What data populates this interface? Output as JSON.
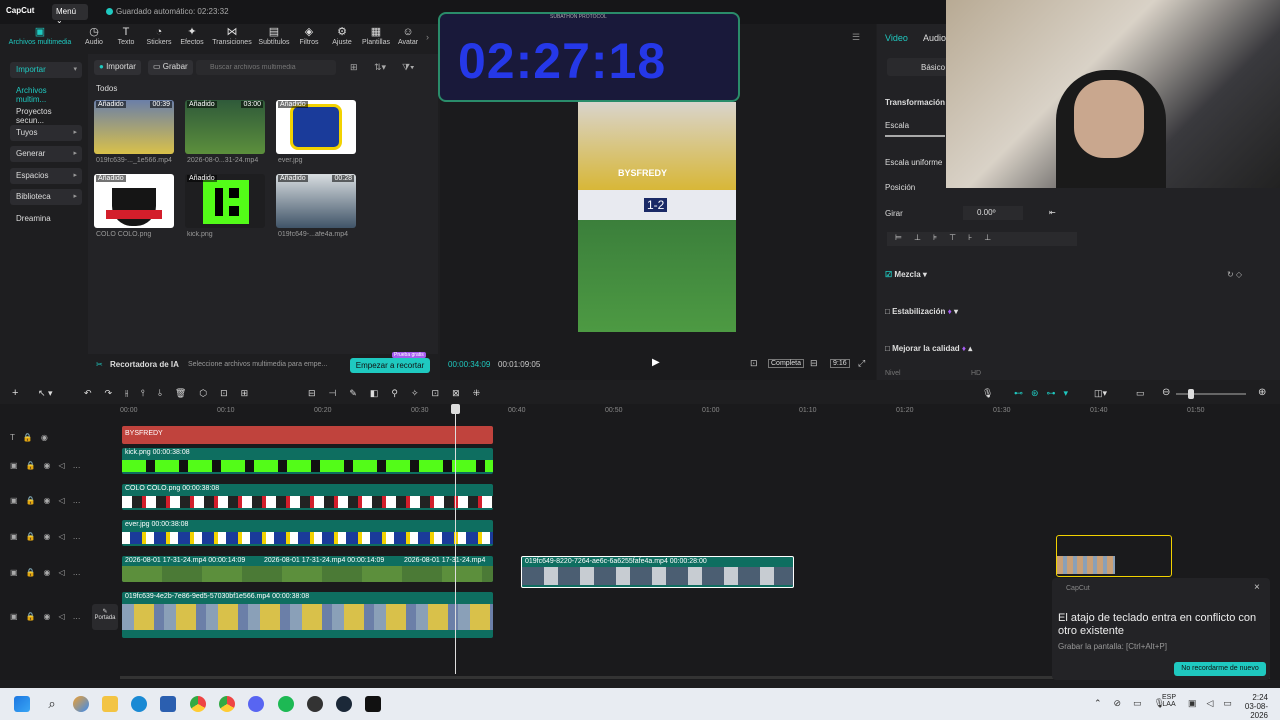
{
  "app": {
    "logo": "CapCut",
    "menu_label": "Menú",
    "autosave": "Guardado automático: 02:23:32"
  },
  "toolbar": [
    {
      "label": "Archivos multimedia",
      "icon": "media-icon",
      "active": true
    },
    {
      "label": "Audio",
      "icon": "audio-icon"
    },
    {
      "label": "Texto",
      "icon": "text-icon"
    },
    {
      "label": "Stickers",
      "icon": "sticker-icon"
    },
    {
      "label": "Efectos",
      "icon": "effects-icon"
    },
    {
      "label": "Transiciones",
      "icon": "transitions-icon"
    },
    {
      "label": "Subtítulos",
      "icon": "subtitles-icon"
    },
    {
      "label": "Filtros",
      "icon": "filters-icon"
    },
    {
      "label": "Ajuste",
      "icon": "adjust-icon"
    },
    {
      "label": "Plantillas",
      "icon": "templates-icon"
    },
    {
      "label": "Avatar",
      "icon": "avatar-icon"
    }
  ],
  "leftnav": [
    {
      "label": "Importar",
      "chevron": "▾"
    },
    {
      "label": "Archivos multim...",
      "selected": true
    },
    {
      "label": "Proyectos secun..."
    },
    {
      "label": "Tuyos",
      "chevron": "▸"
    },
    {
      "label": "Generar",
      "chevron": "▸"
    },
    {
      "label": "Espacios",
      "chevron": "▸"
    },
    {
      "label": "Biblioteca",
      "chevron": "▸"
    },
    {
      "label": "Dreamina"
    }
  ],
  "media": {
    "import_label": "Importar",
    "record_label": "Grabar",
    "search_placeholder": "Buscar archivos multimedia",
    "filter_label": "Todos",
    "items": [
      {
        "name": "019fc639-..._1e566.mp4",
        "added": "Añadido",
        "duration": "00:39"
      },
      {
        "name": "2026-08-0...31-24.mp4",
        "added": "Añadido",
        "duration": "03:00"
      },
      {
        "name": "ever.jpg",
        "added": "Añadido",
        "duration": ""
      },
      {
        "name": "COLO COLO.png",
        "added": "Añadido",
        "duration": ""
      },
      {
        "name": "kick.png",
        "added": "Añadido",
        "duration": ""
      },
      {
        "name": "019fc649-...afe4a.mp4",
        "added": "Añadido",
        "duration": "00:28"
      }
    ],
    "ai_recorder": "Recortadora de IA",
    "ai_hint": "Seleccione archivos multimedia para empe...",
    "ai_button": "Empezar a recortar",
    "ai_badge": "Prueba gratis"
  },
  "preview": {
    "timer": "02:27:18",
    "overlay_title": "SUBATHON PROTOCOL",
    "watermark": "BYSFREDY",
    "current_time": "00:00:34:09",
    "total_time": "00:01:09:05",
    "complete_label": "Completa",
    "ratio_label": "9:16",
    "score_label": "1-2"
  },
  "rpanel": {
    "tab_video": "Video",
    "tab_audio": "Audio",
    "basic_label": "Básico",
    "transform_label": "Transformación",
    "scale_label": "Escala",
    "uniform_scale_label": "Escala uniforme",
    "position_label": "Posición",
    "rotate_label": "Girar",
    "rotate_value": "0.00º",
    "blend_label": "Mezcla",
    "stabilize_label": "Estabilización",
    "quality_label": "Mejorar la calidad",
    "level_label": "Nivel",
    "level_value": "HD"
  },
  "timeline": {
    "ruler": [
      "00:00",
      "00:10",
      "00:20",
      "00:30",
      "00:40",
      "00:50",
      "01:00",
      "01:10",
      "01:20",
      "01:30",
      "01:40",
      "01:50"
    ],
    "text_clip": "BYSFREDY",
    "clips": [
      {
        "label": "kick.png  00:00:38:08"
      },
      {
        "label": "COLO COLO.png  00:00:38:08"
      },
      {
        "label": "ever.jpg  00:00:38:08"
      },
      {
        "label": "2026-08-01 17-31-24.mp4  00:00:14:09"
      },
      {
        "label": "2026-08-01 17-31-24.mp4  00:00:14:09"
      },
      {
        "label": "2026-08-01 17-31-24.mp4"
      },
      {
        "label": "019fc649-8220-7264-ae6c-6a6255fafe4a.mp4  00:00:28:00"
      },
      {
        "label": "019fc639-4e2b-7e86-9ed5-57030bf1e566.mp4  00:00:38:08"
      }
    ],
    "cover_label": "Portada"
  },
  "toast": {
    "app": "CapCut",
    "title": "El atajo de teclado entra en conflicto con otro existente",
    "hint": "Grabar la pantalla: [Ctrl+Alt+P]",
    "button": "No recordarme de nuevo"
  },
  "taskbar": {
    "lang": "ESP",
    "layout": "LAA",
    "time": "2:24",
    "date": "03-08-2026"
  },
  "colors": {
    "accent": "#1fc9c0",
    "text_track": "#c0433d",
    "sticker_track": "#0e6e60",
    "timer_blue": "#2538e8"
  }
}
